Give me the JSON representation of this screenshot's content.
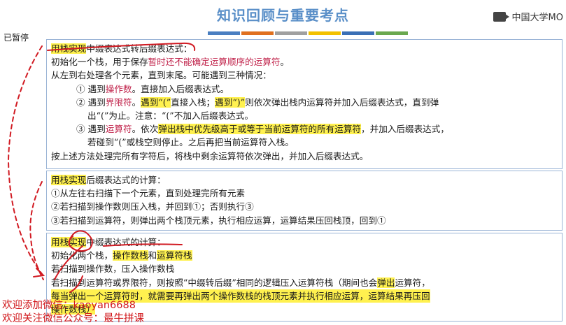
{
  "slide": {
    "title": "知识回顾与重要考点",
    "logo_text": "中国大学MO",
    "paused_label": "已暂停",
    "bar_colors": [
      "#4a7fc1",
      "#e0701f",
      "#a0a0a0",
      "#f2c100",
      "#3a6fb5",
      "#6aa84f"
    ]
  },
  "box1": {
    "l1_a": "用栈实现",
    "l1_b": "中缀表达式转后缀表达式：",
    "l2_a": "初始化一个栈，用于保存",
    "l2_b": "暂时还不能确定运算顺序的运算符",
    "l2_c": "。",
    "l3": "从左到右处理各个元素，直到末尾。可能遇到三种情况：",
    "l4_a": "① 遇到",
    "l4_b": "操作数",
    "l4_c": "。直接加入后缀表达式。",
    "l5_a": "② 遇到",
    "l5_b": "界限符",
    "l5_c": "。",
    "l5_d": "遇到“(”",
    "l5_e": "直接入栈；",
    "l5_f": "遇到“)”",
    "l5_g": "则依次弹出栈内运算符并加入后缀表达式，直到弹",
    "l6": "出“(”为止。注意：“(”不加入后缀表达式。",
    "l7_a": "③ 遇到",
    "l7_b": "运算符",
    "l7_c": "。依次",
    "l7_d": "弹出栈中优先级高于或等于当前运算符的所有运算符",
    "l7_e": "，并加入后缀表达式，",
    "l8": "若碰到“(”或栈空则停止。之后再把当前运算符入栈。",
    "l9": "按上述方法处理完所有字符后，将栈中剩余运算符依次弹出，并加入后缀表达式。"
  },
  "box2": {
    "l1_a": "用栈实现",
    "l1_b": "后缀表达式的计算：",
    "l2": "①从左往右扫描下一个元素，直到处理完所有元素",
    "l3": "②若扫描到操作数则压入栈，并回到①；否则执行③",
    "l4": "③若扫描到运算符，则弹出两个栈顶元素，执行相应运算，运算结果压回栈顶，回到①"
  },
  "box3": {
    "l1_a": "用栈实现",
    "l1_b": "中缀表达式的计算：",
    "l2_a": "初始化两个栈，",
    "l2_b": "操作数栈",
    "l2_c": "和",
    "l2_d": "运算符栈",
    "l3": "若扫描到操作数，压入操作数栈",
    "l4_a": "若扫描到运算符或界限符，则按照“中缀转后缀”相同的逻辑压入运算符栈（期间也会",
    "l4_b": "弹出",
    "l4_c": "运算符，",
    "l5_a": "每当弹出一个运算符时，就需要再弹出两个操作数栈的栈顶元素并执行相应运算，运算结果再压回",
    "l6": "操作数栈）"
  },
  "watermark": {
    "line1": "欢迎添加微信：kaoyan6688",
    "line2": "欢迎关注微信公众号：最牛拼课"
  }
}
